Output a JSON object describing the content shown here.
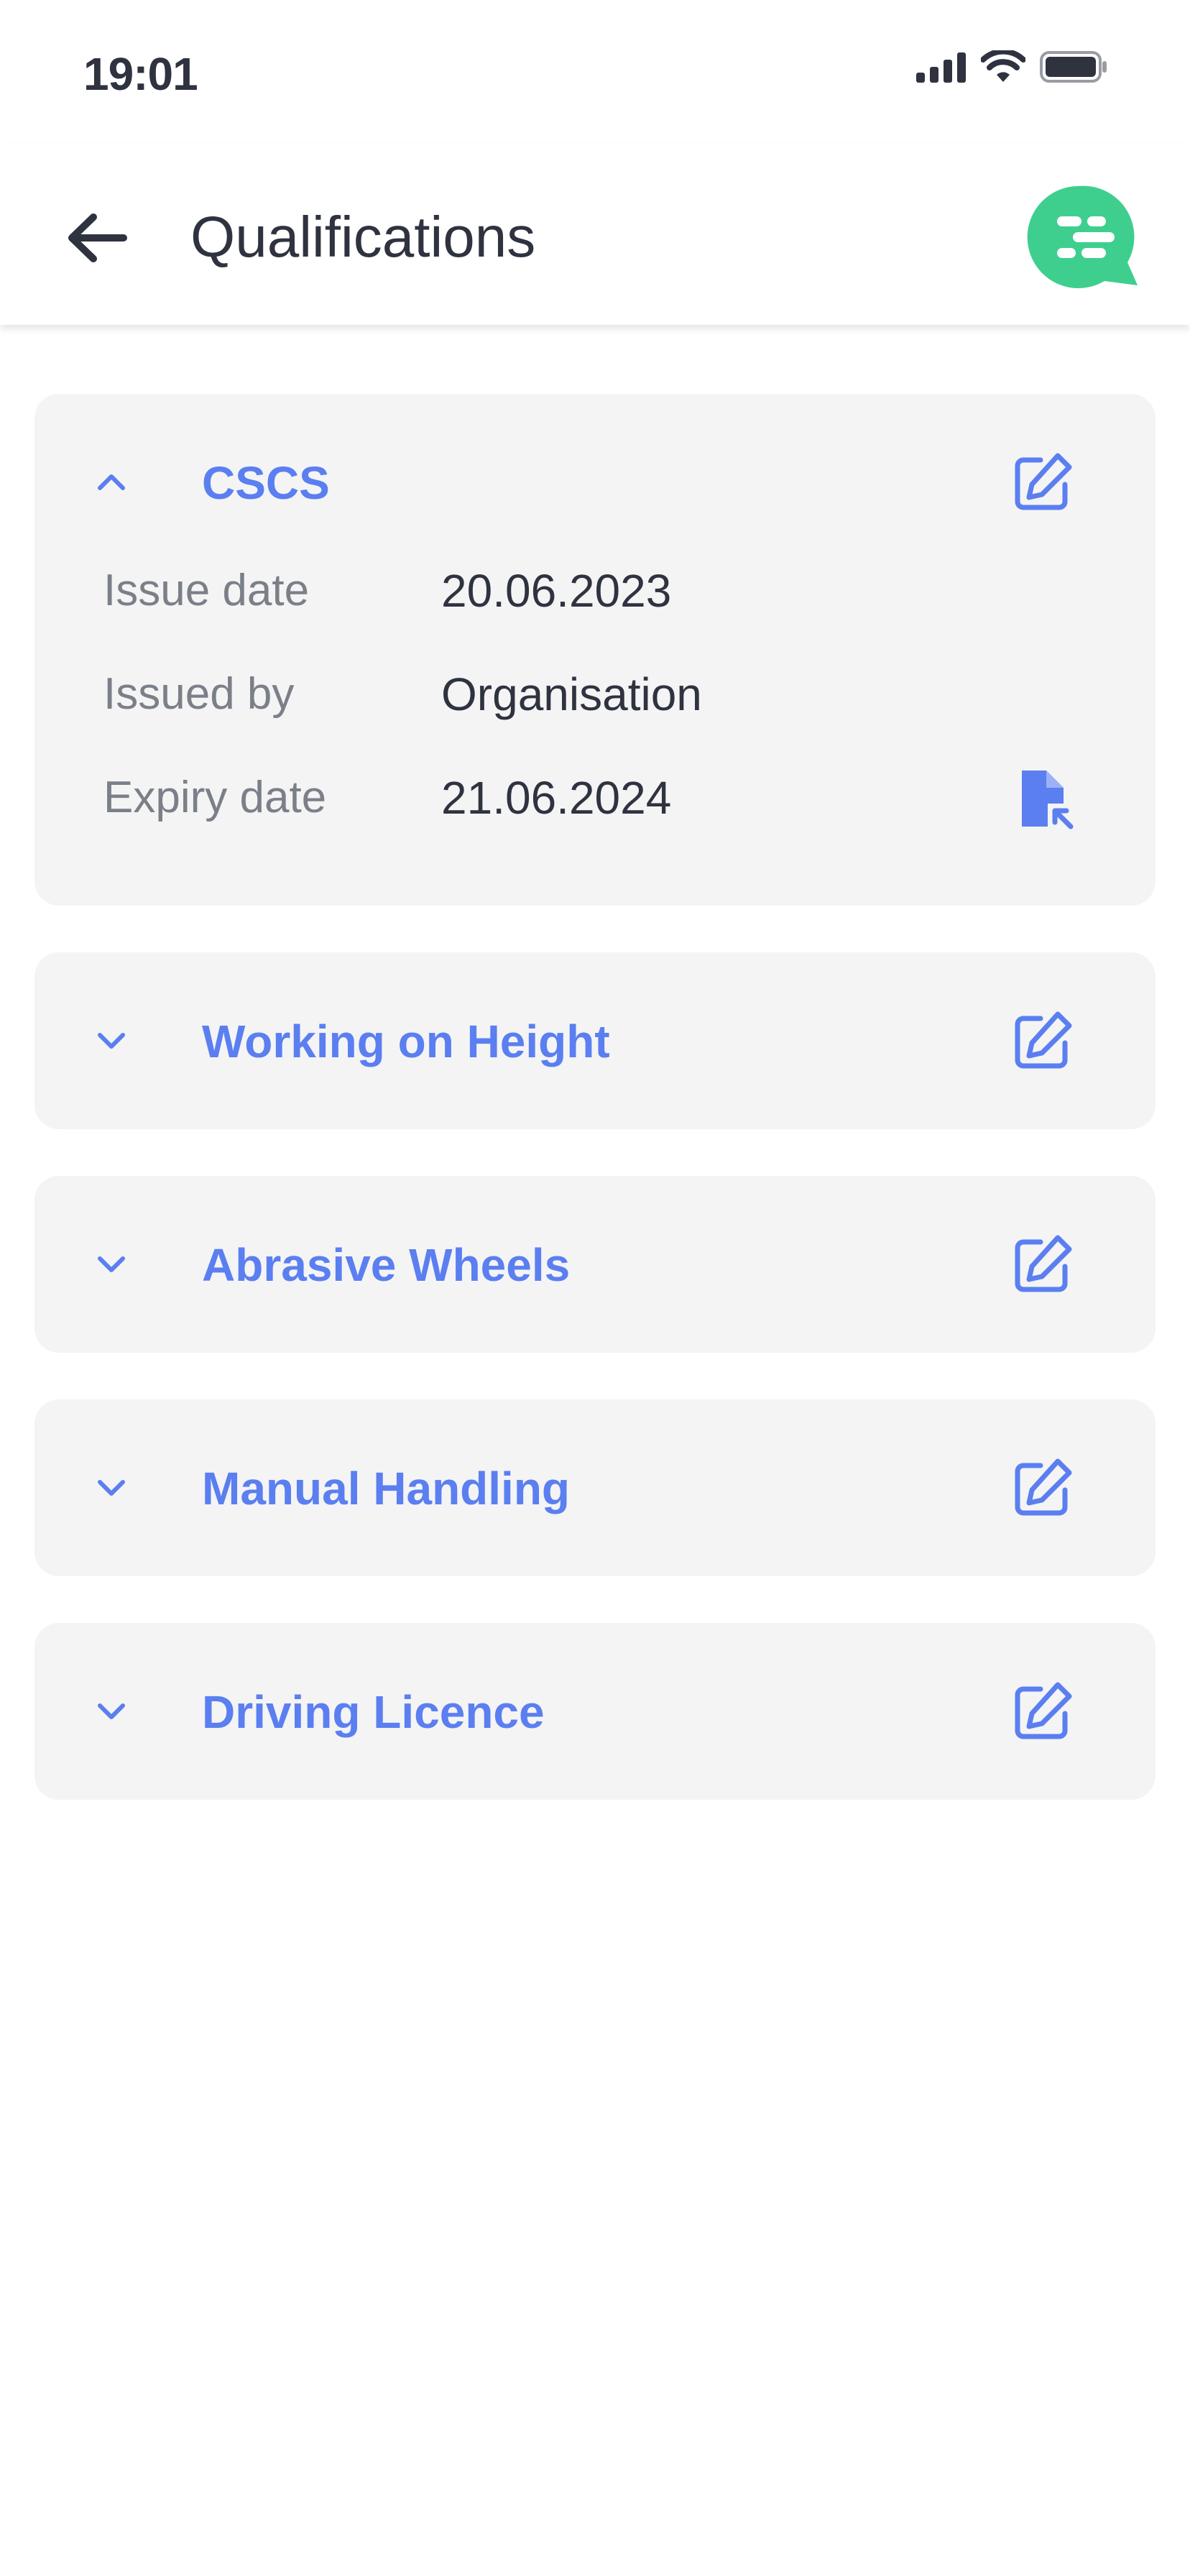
{
  "status_bar": {
    "time": "19:01",
    "icons": [
      "signal-icon",
      "wifi-icon",
      "battery-icon"
    ]
  },
  "header": {
    "title": "Qualifications",
    "back_icon": "arrow-left-icon",
    "chat_icon": "chat-bubble-icon"
  },
  "colors": {
    "accent": "#5b7ff0",
    "chat": "#3ecf8e",
    "card_bg": "#f4f4f5",
    "text": "#2f3340",
    "muted": "#7b7f88"
  },
  "qualifications": [
    {
      "title": "CSCS",
      "expanded": true,
      "details": [
        {
          "label": "Issue date",
          "value": "20.06.2023"
        },
        {
          "label": "Issued by",
          "value": "Organisation"
        },
        {
          "label": "Expiry date",
          "value": "21.06.2024"
        }
      ]
    },
    {
      "title": "Working on Height",
      "expanded": false
    },
    {
      "title": "Abrasive Wheels",
      "expanded": false
    },
    {
      "title": "Manual Handling",
      "expanded": false
    },
    {
      "title": "Driving Licence",
      "expanded": false
    }
  ]
}
